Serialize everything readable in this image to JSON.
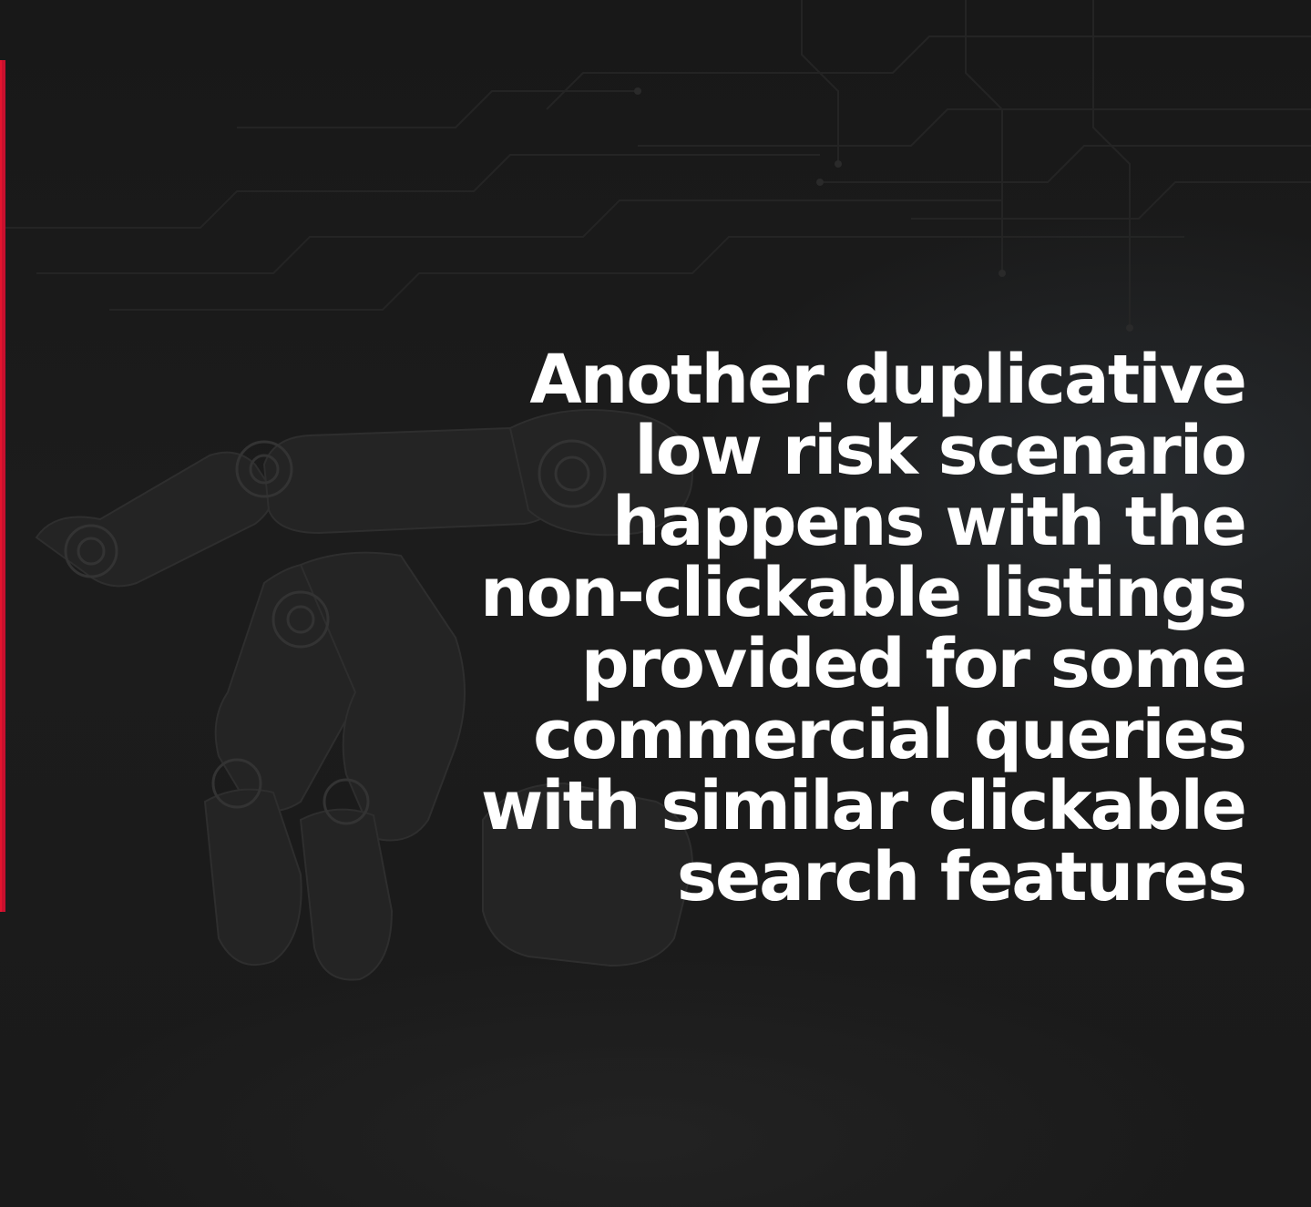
{
  "slide": {
    "accent_color": "#c8102e",
    "background_color": "#1b1b1b",
    "text_color": "#ffffff",
    "background_image": "robotic-hand-circuit-icon",
    "headline_lines": [
      "Another duplicative",
      "low risk scenario",
      "happens with the",
      "non-clickable listings",
      "provided for some",
      "commercial queries",
      "with similar clickable",
      "search features"
    ]
  }
}
